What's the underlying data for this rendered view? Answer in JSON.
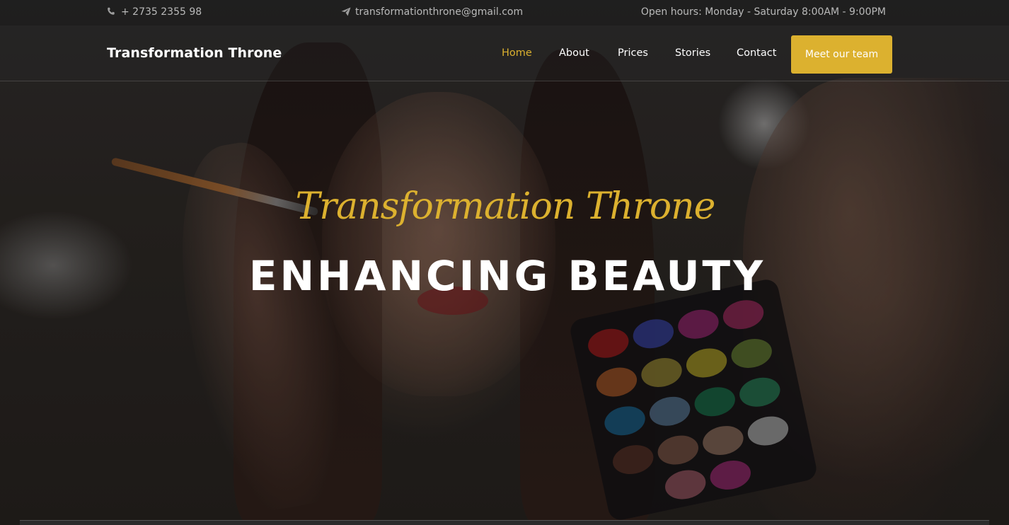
{
  "topbar": {
    "phone": "+ 2735 2355 98",
    "email": "transformationthrone@gmail.com",
    "hours": "Open hours: Monday - Saturday 8:00AM - 9:00PM",
    "phone_icon": "phone-icon",
    "email_icon": "paper-plane-icon"
  },
  "navbar": {
    "brand": "Transformation Throne",
    "links": [
      {
        "label": "Home",
        "active": true
      },
      {
        "label": "About",
        "active": false
      },
      {
        "label": "Prices",
        "active": false
      },
      {
        "label": "Stories",
        "active": false
      },
      {
        "label": "Contact",
        "active": false
      }
    ],
    "cta_label": "Meet our team"
  },
  "hero": {
    "script_title": "Transformation Throne",
    "title": "ENHANCING BEAUTY"
  },
  "colors": {
    "accent": "#dcb12f",
    "text": "#ffffff",
    "muted": "#b9b9b9"
  }
}
